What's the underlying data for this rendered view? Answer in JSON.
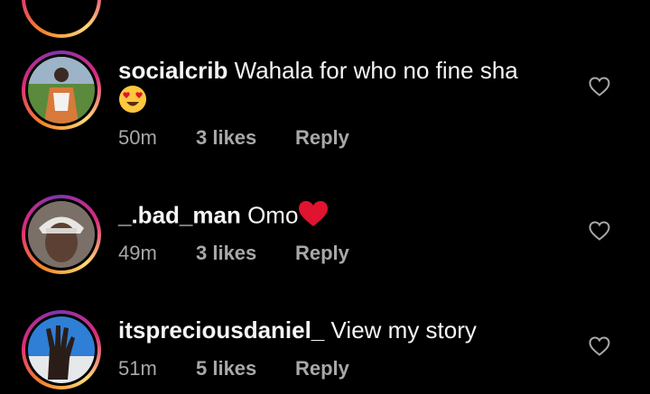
{
  "comments": [
    {
      "username": "socialcrib",
      "text": "Wahala for who no fine sha",
      "emoji": "smiling-face-with-heart-eyes",
      "time": "50m",
      "likes": "3 likes",
      "reply": "Reply"
    },
    {
      "username": "_.bad_man",
      "text": "Omo",
      "emoji": "red-heart",
      "time": "49m",
      "likes": "3 likes",
      "reply": "Reply"
    },
    {
      "username": "itspreciousdaniel_",
      "text": "View my story",
      "time": "51m",
      "likes": "5 likes",
      "reply": "Reply"
    }
  ],
  "colors": {
    "background": "#000000",
    "text": "#f5f5f5",
    "meta": "#a8a8a8",
    "emoji_heart": "#e0142e",
    "emoji_face": "#ffc83d"
  },
  "icons": {
    "like": "heart-outline-icon"
  }
}
